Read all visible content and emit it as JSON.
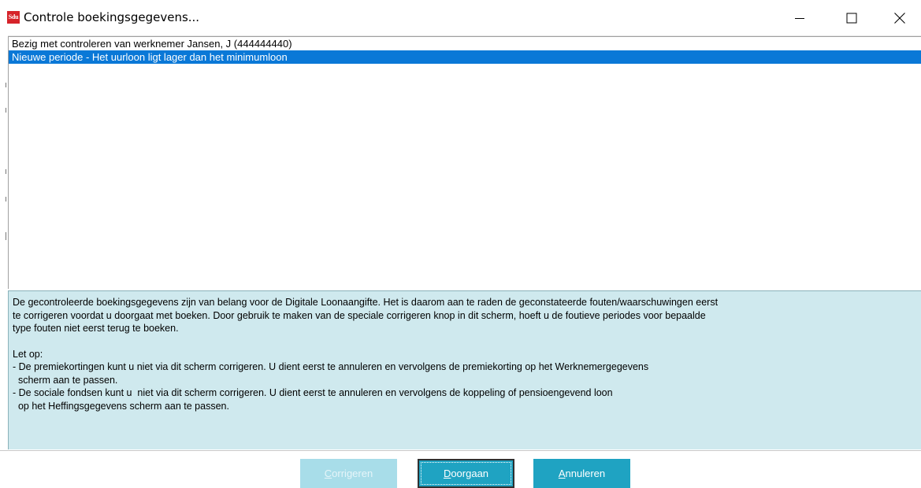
{
  "window": {
    "icon_text": "Sdu",
    "title": "Controle boekingsgegevens...",
    "controls": {
      "minimize": "minimize-icon",
      "maximize": "maximize-icon",
      "close": "close-icon"
    }
  },
  "list": {
    "items": [
      {
        "text": "Bezig met controleren van werknemer Jansen, J (444444440)",
        "selected": false
      },
      {
        "text": "Nieuwe periode - Het uurloon ligt lager dan het minimumloon",
        "selected": true
      }
    ],
    "selected_color": "#0a78d7"
  },
  "info": {
    "paragraph_lines": [
      "De gecontroleerde boekingsgegevens zijn van belang voor de Digitale Loonaangifte. Het is daarom aan te raden de geconstateerde fouten/waarschuwingen eerst",
      "te corrigeren voordat u doorgaat met boeken. Door gebruik te maken van de speciale corrigeren knop in dit scherm, hoeft u de foutieve periodes voor bepaalde",
      "type fouten niet eerst terug te boeken."
    ],
    "note_lines": [
      "Let op:",
      "- De premiekortingen kunt u niet via dit scherm corrigeren. U dient eerst te annuleren en vervolgens de premiekorting op het Werknemergegevens",
      "  scherm aan te passen.",
      "- De sociale fondsen kunt u  niet via dit scherm corrigeren. U dient eerst te annuleren en vervolgens de koppeling of pensioengevend loon",
      "  op het Heffingsgegevens scherm aan te passen."
    ],
    "background_color": "#cfe9ee"
  },
  "buttons": {
    "corrigeren": {
      "hotkey": "C",
      "rest": "orrigeren",
      "enabled": false
    },
    "doorgaan": {
      "hotkey": "D",
      "rest": "oorgaan",
      "enabled": true,
      "focused": true
    },
    "annuleren": {
      "hotkey": "A",
      "rest": "nnuleren",
      "enabled": true
    },
    "accent_color": "#1fa3c2"
  }
}
